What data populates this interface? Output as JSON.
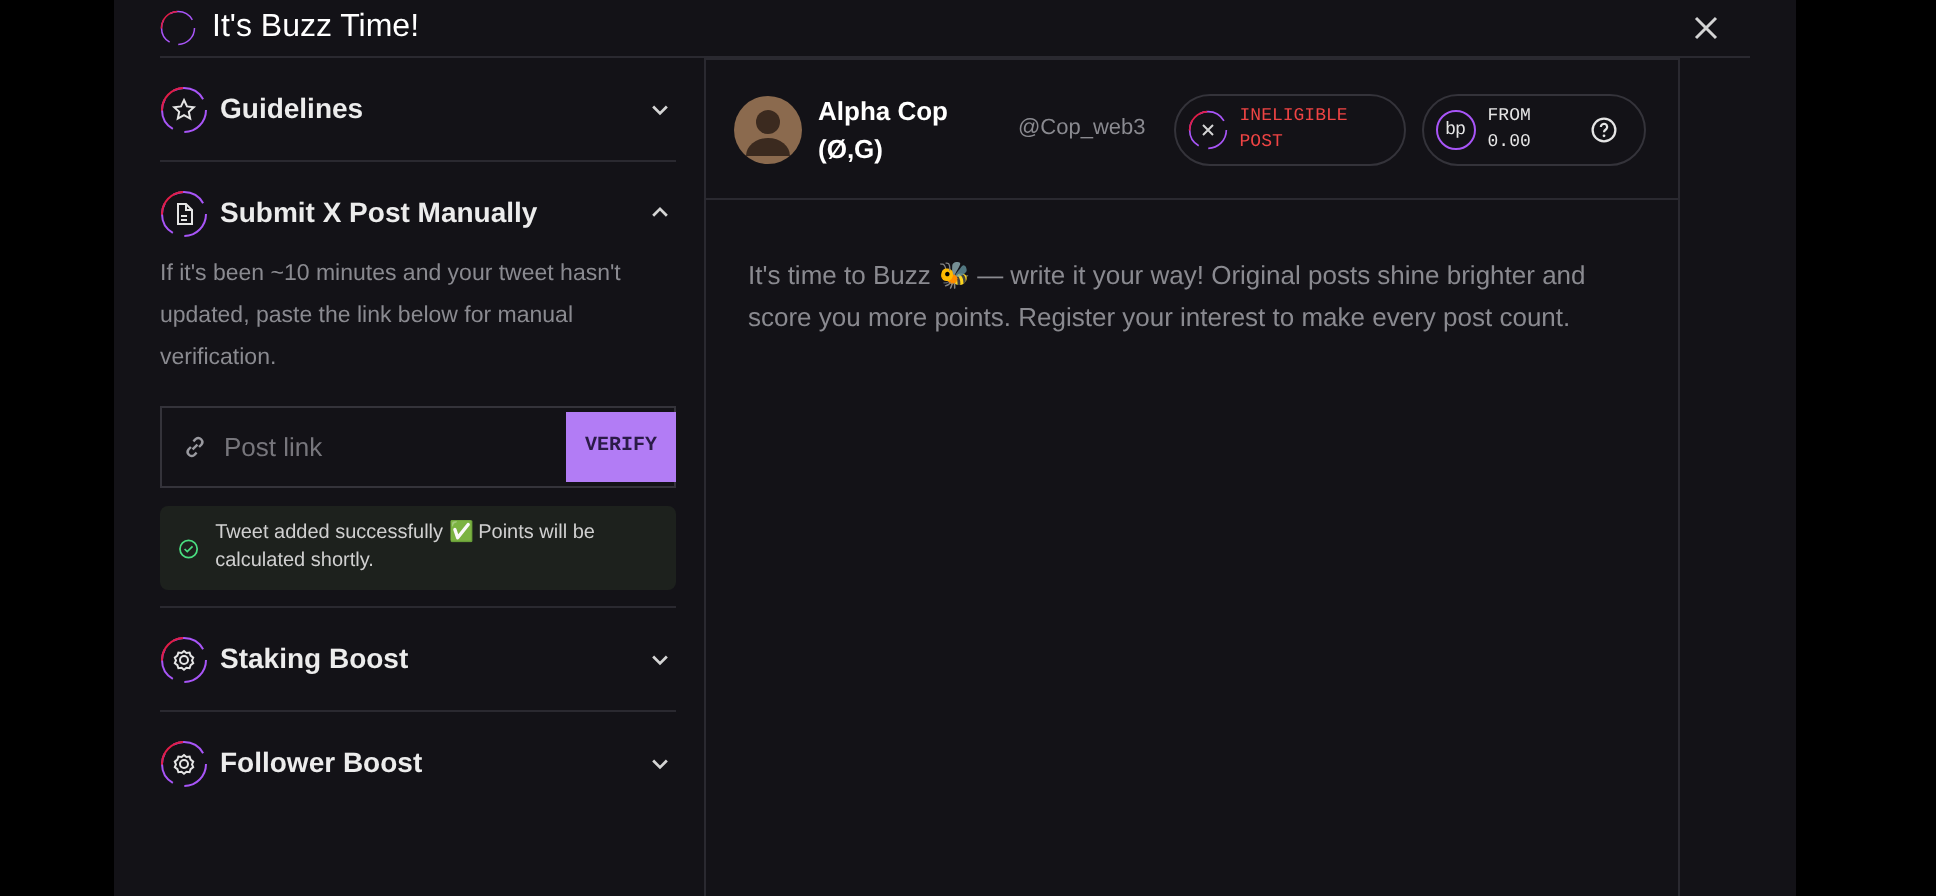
{
  "dialog": {
    "title": "It's Buzz Time!"
  },
  "sections": [
    {
      "kind": "star",
      "title": "Guidelines",
      "expanded": false
    },
    {
      "kind": "document",
      "title": "Submit X Post Manually",
      "expanded": true,
      "description": "If it's been ~10 minutes and your tweet hasn't updated, paste the link below for manual verification.",
      "field": {
        "placeholder": "Post link"
      },
      "button": "VERIFY",
      "notice": "Tweet added successfully ✅ Points will be calculated shortly."
    },
    {
      "kind": "gear",
      "title": "Staking Boost",
      "expanded": false
    },
    {
      "kind": "gear",
      "title": "Follower Boost",
      "expanded": false
    }
  ],
  "post": {
    "name": "Alpha Cop (Ø,G)",
    "handle": "@Cop_web3",
    "status": "INELIGIBLE POST",
    "points_badge": "bp",
    "points": "FROM 0.00",
    "body": "It's time to Buzz 🐝 — write it your way! Original posts shine brighter and score you more points. Register your interest to make every post count."
  }
}
